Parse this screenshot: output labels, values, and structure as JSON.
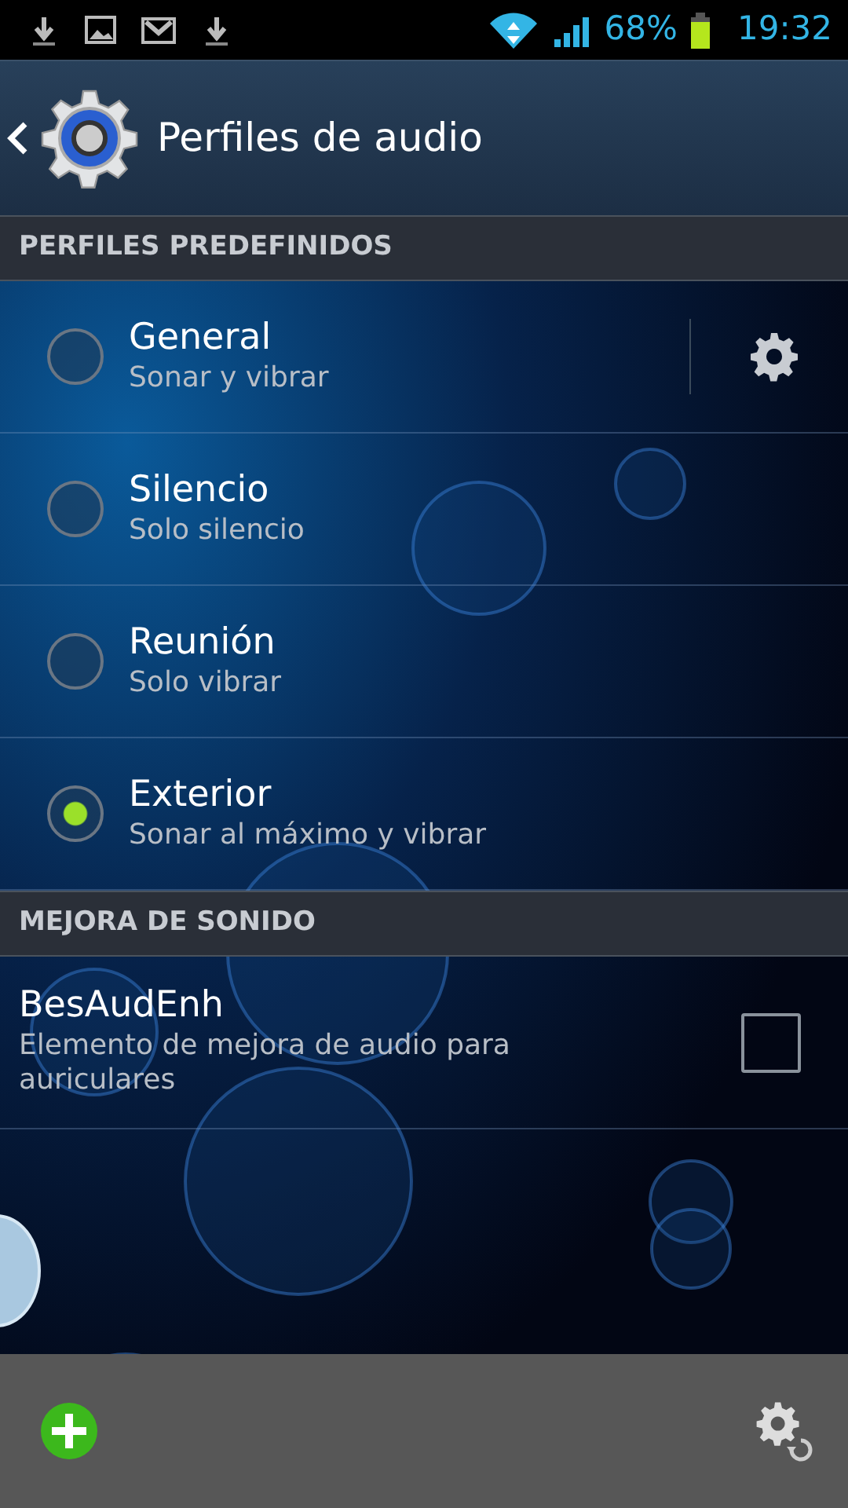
{
  "status_bar": {
    "battery": "68%",
    "time": "19:32"
  },
  "action_bar": {
    "title": "Perfiles de audio"
  },
  "sections": [
    {
      "title": "PERFILES PREDEFINIDOS",
      "kind": "radio",
      "items": [
        {
          "title": "General",
          "subtitle": "Sonar y vibrar",
          "selected": false,
          "settings": true
        },
        {
          "title": "Silencio",
          "subtitle": "Solo silencio",
          "selected": false,
          "settings": false
        },
        {
          "title": "Reunión",
          "subtitle": "Solo vibrar",
          "selected": false,
          "settings": false
        },
        {
          "title": "Exterior",
          "subtitle": "Sonar al máximo y vibrar",
          "selected": true,
          "settings": false
        }
      ]
    },
    {
      "title": "MEJORA DE SONIDO",
      "kind": "checkbox",
      "items": [
        {
          "title": "BesAudEnh",
          "subtitle": "Elemento de mejora de audio para auriculares",
          "checked": false
        }
      ]
    }
  ]
}
